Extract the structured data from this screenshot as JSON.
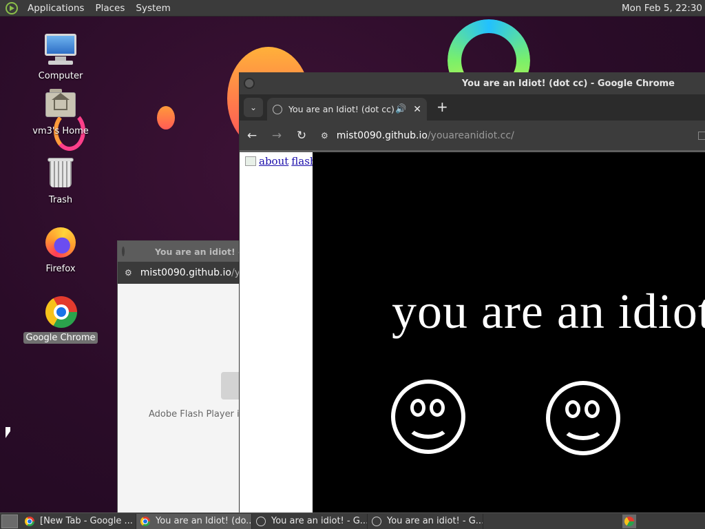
{
  "top_panel": {
    "menus": [
      "Applications",
      "Places",
      "System"
    ],
    "clock": "Mon Feb  5, 22:30"
  },
  "desktop_icons": [
    {
      "label": "Computer",
      "icon": "computer-icon"
    },
    {
      "label": "vm3's Home",
      "icon": "home-folder-icon"
    },
    {
      "label": "Trash",
      "icon": "trash-icon"
    },
    {
      "label": "Firefox",
      "icon": "firefox-icon"
    },
    {
      "label": "Google Chrome",
      "icon": "chrome-icon",
      "selected": true
    }
  ],
  "back_window": {
    "title": "You are an idiot! - Google Chrome",
    "url_host": "mist0090.github.io",
    "url_path": "/youareanidiot.cc/",
    "flash_message": "Adobe Flash Player is"
  },
  "front_window": {
    "title": "You are an Idiot! (dot cc) - Google Chrome",
    "tab_label": "You are an Idiot! (dot cc)",
    "url_host": "mist0090.github.io",
    "url_path": "/youareanidiot.cc/",
    "links": [
      "about",
      "flash"
    ],
    "headline": "you are an idiot!"
  },
  "taskbar": {
    "tasks": [
      {
        "label": "[New Tab - Google ...",
        "icon": "chrome-icon",
        "active": false
      },
      {
        "label": "You are an Idiot! (do...",
        "icon": "chrome-icon",
        "active": true
      },
      {
        "label": "You are an idiot! - G...",
        "icon": "globe-icon",
        "active": false
      },
      {
        "label": "You are an idiot! - G...",
        "icon": "globe-icon",
        "active": false
      }
    ]
  }
}
